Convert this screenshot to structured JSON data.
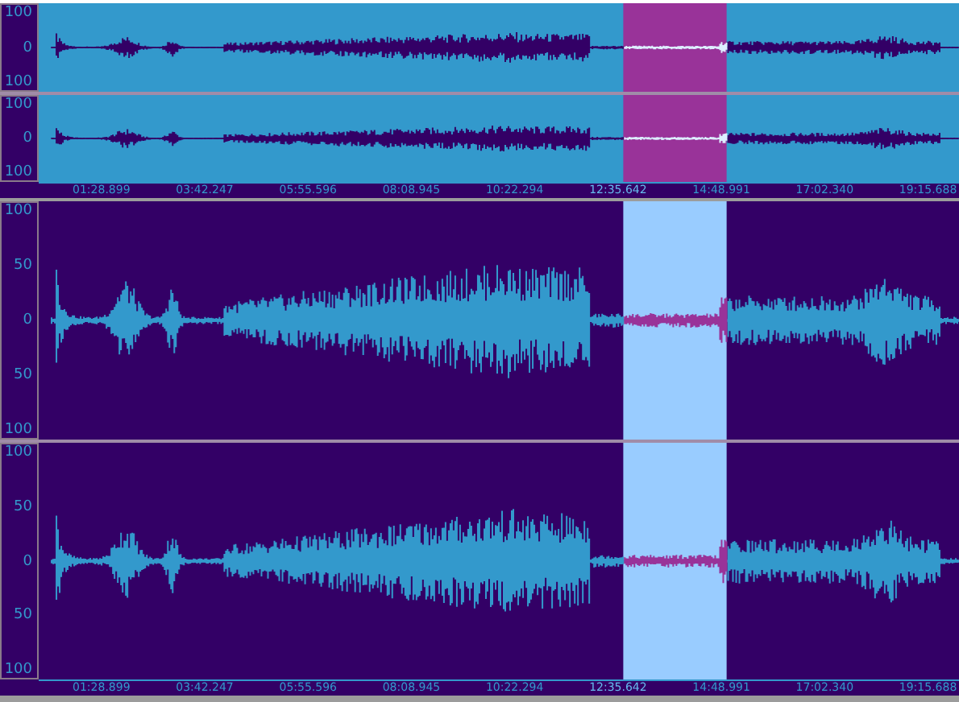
{
  "overview": {
    "channels": [
      {
        "scale": [
          "100",
          "0",
          "100"
        ]
      },
      {
        "scale": [
          "100",
          "0",
          "100"
        ]
      }
    ],
    "ruler": {
      "ticks": [
        {
          "label": "01:28.899",
          "selected": false
        },
        {
          "label": "03:42.247",
          "selected": false
        },
        {
          "label": "05:55.596",
          "selected": false
        },
        {
          "label": "08:08.945",
          "selected": false
        },
        {
          "label": "10:22.294",
          "selected": false
        },
        {
          "label": "12:35.642",
          "selected": true
        },
        {
          "label": "14:48.991",
          "selected": false
        },
        {
          "label": "17:02.340",
          "selected": false
        },
        {
          "label": "19:15.688",
          "selected": false
        }
      ]
    }
  },
  "main": {
    "channels": [
      {
        "scale": [
          "100",
          "50",
          "0",
          "50",
          "100"
        ]
      },
      {
        "scale": [
          "100",
          "50",
          "0",
          "50",
          "100"
        ]
      }
    ],
    "ruler": {
      "ticks": [
        {
          "label": "01:28.899",
          "selected": false
        },
        {
          "label": "03:42.247",
          "selected": false
        },
        {
          "label": "05:55.596",
          "selected": false
        },
        {
          "label": "08:08.945",
          "selected": false
        },
        {
          "label": "10:22.294",
          "selected": false
        },
        {
          "label": "12:35.642",
          "selected": true
        },
        {
          "label": "14:48.991",
          "selected": false
        },
        {
          "label": "17:02.340",
          "selected": false
        },
        {
          "label": "19:15.688",
          "selected": false
        }
      ]
    }
  }
}
